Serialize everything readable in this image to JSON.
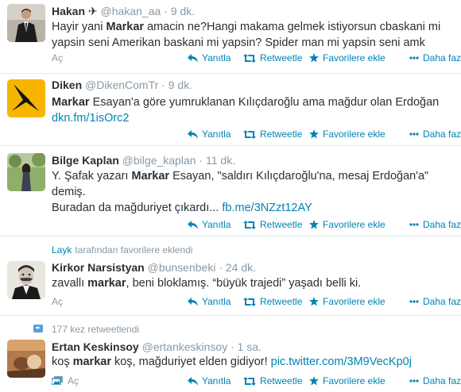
{
  "tweets": [
    {
      "name": "Hakan",
      "name_glyph": "✈",
      "handle": "@hakan_aa",
      "sep": "·",
      "time": "9 dk.",
      "lines": [
        [
          {
            "t": "Hayir yani "
          },
          {
            "t": "Markar",
            "b": true
          },
          {
            "t": " amacin ne?Hangi makama gelmek istiyorsun cbaskani mi"
          }
        ],
        [
          {
            "t": "yapsin seni Amerikan baskani mi yapsin? Spider man mi yapsin seni amk"
          }
        ]
      ],
      "open": "Aç",
      "reply": "Yanıtla",
      "retweet": "Retweetle",
      "favorite": "Favorilere ekle",
      "more": "Daha fazla"
    },
    {
      "name": "Diken",
      "handle": "@DikenComTr",
      "sep": "·",
      "time": "9 dk.",
      "lines": [
        [
          {
            "t": "Markar",
            "b": true
          },
          {
            "t": " Esayan'a göre yumruklanan Kılıçdaroğlu ama mağdur olan Erdoğan"
          }
        ],
        [
          {
            "t": "dkn.fm/1isOrc2",
            "link": true
          }
        ]
      ],
      "reply": "Yanıtla",
      "retweet": "Retweetle",
      "favorite": "Favorilere ekle",
      "more": "Daha fazla"
    },
    {
      "name": "Bilge Kaplan",
      "handle": "@bilge_kaplan",
      "sep": "·",
      "time": "11 dk.",
      "lines": [
        [
          {
            "t": "Y. Şafak yazarı "
          },
          {
            "t": "Markar",
            "b": true
          },
          {
            "t": " Esayan, \"saldırı Kılıçdaroğlu'na, mesaj Erdoğan'a\""
          }
        ],
        [
          {
            "t": "demiş."
          }
        ],
        [
          {
            "t": "Buradan da mağduriyet çıkardı... "
          },
          {
            "t": "fb.me/3NZzt12AY",
            "link": true
          }
        ]
      ],
      "reply": "Yanıtla",
      "retweet": "Retweetle",
      "favorite": "Favorilere ekle",
      "more": "Daha fazla"
    },
    {
      "context_user": "Layk",
      "context_text": "tarafından favorilere eklendi",
      "name": "Kirkor Narsistyan",
      "handle": "@bunsenbeki",
      "sep": "·",
      "time": "24 dk.",
      "lines": [
        [
          {
            "t": "zavallı "
          },
          {
            "t": "markar",
            "b": true
          },
          {
            "t": ", beni bloklamış. “büyük trajedi” yaşadı belli ki."
          }
        ]
      ],
      "open": "Aç",
      "reply": "Yanıtla",
      "retweet": "Retweetle",
      "favorite": "Favorilere ekle",
      "more": "Daha fazla"
    },
    {
      "context_text": "177 kez retweetlendi",
      "name": "Ertan Keskinsoy",
      "handle": "@ertankeskinsoy",
      "sep": "·",
      "time": "1 sa.",
      "lines": [
        [
          {
            "t": "koş "
          },
          {
            "t": "markar",
            "b": true
          },
          {
            "t": " koş, mağduriyet elden gidiyor! "
          },
          {
            "t": "pic.twitter.com/3M9VecKp0j",
            "link": true
          }
        ]
      ],
      "open": "Aç",
      "reply": "Yanıtla",
      "retweet": "Retweetle",
      "favorite": "Favorilere ekle",
      "more": "Daha fazla"
    }
  ],
  "colors": {
    "link": "#0084b4",
    "muted": "#8899a6",
    "text": "#292f33",
    "divider": "#e1e8ed",
    "diken_bg": "#f7b500"
  },
  "icons": [
    "plane-icon",
    "reply-icon",
    "retweet-icon",
    "star-icon",
    "more-dots-icon",
    "media-icon"
  ]
}
